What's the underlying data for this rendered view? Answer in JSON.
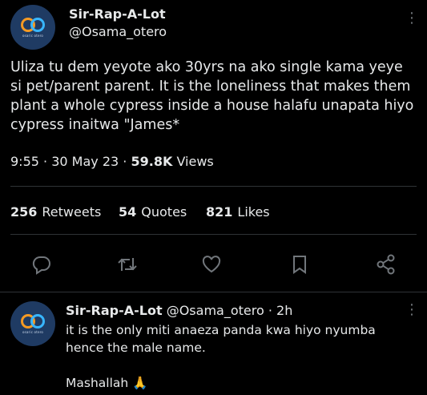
{
  "colors": {
    "background": "#000000",
    "text": "#e7e9ea",
    "muted": "#71767b",
    "divider": "#2f3336"
  },
  "tweet": {
    "author_name": "Sir-Rap-A-Lot",
    "author_handle": "@Osama_otero",
    "avatar_caption": "osaric otero",
    "text": "Uliza tu dem yeyote ako 30yrs na ako single kama yeye si pet/parent parent. It is the loneliness that makes them plant a whole cypress inside a house halafu unapata hiyo cypress inaitwa \"James*",
    "time": "9:55",
    "date": "30 May 23",
    "views_count": "59.8K",
    "views_label": "Views",
    "separator": "·",
    "stats": [
      {
        "count": "256",
        "label": "Retweets"
      },
      {
        "count": "54",
        "label": "Quotes"
      },
      {
        "count": "821",
        "label": "Likes"
      }
    ],
    "actions": [
      "reply-icon",
      "retweet-icon",
      "like-icon",
      "bookmark-icon",
      "share-icon"
    ]
  },
  "reply": {
    "author_name": "Sir-Rap-A-Lot",
    "author_handle": "@Osama_otero",
    "separator": "·",
    "age": "2h",
    "avatar_caption": "osaric otero",
    "text": "it is the only miti anaeza panda kwa hiyo nyumba hence the male name.",
    "text2": "Mashallah",
    "emoji": "🙏"
  },
  "more_glyph": "⋮"
}
